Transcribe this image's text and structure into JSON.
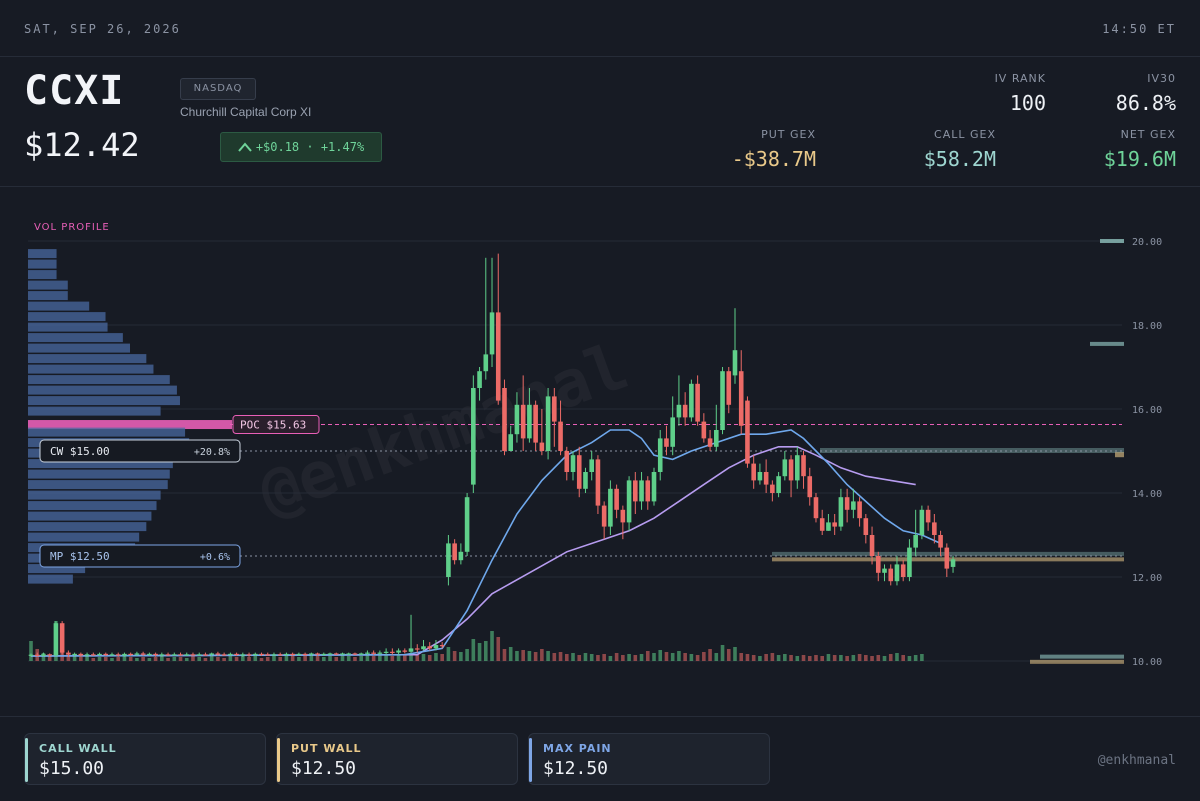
{
  "topbar": {
    "date": "SAT, SEP 26, 2026",
    "time": "14:50 ET"
  },
  "header": {
    "ticker": "CCXI",
    "price": "$12.42",
    "exchange": "NASDAQ",
    "company": "Churchill Capital Corp XI",
    "change": "+$0.18 · +1.47%",
    "change_icon": "chevron-up-icon"
  },
  "metrics": {
    "iv_rank": {
      "label": "IV RANK",
      "value": "100"
    },
    "iv30": {
      "label": "IV30",
      "value": "86.8%"
    },
    "put_gex": {
      "label": "PUT GEX",
      "value": "-$38.7M"
    },
    "call_gex": {
      "label": "CALL GEX",
      "value": "$58.2M"
    },
    "net_gex": {
      "label": "NET GEX",
      "value": "$19.6M"
    }
  },
  "colors": {
    "up": "#5fcf8a",
    "down": "#ec6b67",
    "ma_fast": "#6fa8ec",
    "ma_slow": "#b79cf0",
    "poc": "#e85fb7",
    "call": "#9ed6d0",
    "put": "#e9c98a",
    "maxpain": "#7ea6e6",
    "net": "#6fd49a"
  },
  "chart_data": {
    "type": "candlestick",
    "y_ticks": [
      "20.00",
      "18.00",
      "16.00",
      "14.00",
      "12.00",
      "10.00"
    ],
    "ylim": [
      10,
      20
    ],
    "vol_profile_label": "VOL PROFILE",
    "levels": [
      {
        "name": "poc",
        "label": "POC $15.63",
        "price": 15.63
      },
      {
        "name": "cw",
        "label": "CW $15.00",
        "pct": "+20.8%",
        "price": 15.0
      },
      {
        "name": "mp",
        "label": "MP $12.50",
        "pct": "+0.6%",
        "price": 12.5
      }
    ],
    "price_walls": [
      20.0,
      17.55,
      15.0,
      12.45,
      10.05
    ],
    "candles": [
      [
        10.13,
        10.15,
        10.1,
        10.18
      ],
      [
        10.15,
        10.12,
        10.1,
        10.2
      ],
      [
        10.12,
        10.16,
        10.1,
        10.2
      ],
      [
        10.16,
        10.13,
        10.1,
        10.18
      ],
      [
        10.13,
        10.9,
        10.1,
        10.95
      ],
      [
        10.9,
        10.2,
        10.15,
        10.95
      ],
      [
        10.2,
        10.15,
        10.1,
        10.25
      ],
      [
        10.15,
        10.17,
        10.1,
        10.2
      ],
      [
        10.17,
        10.13,
        10.1,
        10.2
      ],
      [
        10.13,
        10.16,
        10.1,
        10.2
      ],
      [
        10.16,
        10.15,
        10.12,
        10.2
      ],
      [
        10.15,
        10.17,
        10.12,
        10.2
      ],
      [
        10.17,
        10.14,
        10.12,
        10.2
      ],
      [
        10.14,
        10.16,
        10.12,
        10.2
      ],
      [
        10.16,
        10.13,
        10.1,
        10.2
      ],
      [
        10.13,
        10.17,
        10.1,
        10.2
      ],
      [
        10.17,
        10.15,
        10.12,
        10.2
      ],
      [
        10.15,
        10.18,
        10.12,
        10.22
      ],
      [
        10.18,
        10.15,
        10.12,
        10.22
      ],
      [
        10.15,
        10.17,
        10.12,
        10.2
      ],
      [
        10.17,
        10.14,
        10.1,
        10.2
      ],
      [
        10.14,
        10.16,
        10.1,
        10.2
      ],
      [
        10.16,
        10.15,
        10.12,
        10.2
      ],
      [
        10.15,
        10.16,
        10.12,
        10.2
      ],
      [
        10.16,
        10.14,
        10.12,
        10.2
      ],
      [
        10.14,
        10.16,
        10.12,
        10.2
      ],
      [
        10.16,
        10.15,
        10.12,
        10.2
      ],
      [
        10.15,
        10.16,
        10.12,
        10.2
      ],
      [
        10.16,
        10.15,
        10.12,
        10.2
      ],
      [
        10.15,
        10.18,
        10.12,
        10.2
      ],
      [
        10.18,
        10.16,
        10.12,
        10.22
      ],
      [
        10.16,
        10.15,
        10.12,
        10.2
      ],
      [
        10.15,
        10.17,
        10.12,
        10.2
      ],
      [
        10.17,
        10.15,
        10.12,
        10.2
      ],
      [
        10.15,
        10.16,
        10.1,
        10.2
      ],
      [
        10.16,
        10.14,
        10.1,
        10.2
      ],
      [
        10.14,
        10.17,
        10.12,
        10.2
      ],
      [
        10.17,
        10.16,
        10.12,
        10.2
      ],
      [
        10.16,
        10.15,
        10.12,
        10.2
      ],
      [
        10.15,
        10.16,
        10.12,
        10.2
      ],
      [
        10.16,
        10.15,
        10.12,
        10.2
      ],
      [
        10.15,
        10.17,
        10.12,
        10.2
      ],
      [
        10.17,
        10.16,
        10.12,
        10.2
      ],
      [
        10.16,
        10.17,
        10.12,
        10.2
      ],
      [
        10.17,
        10.16,
        10.12,
        10.2
      ],
      [
        10.16,
        10.18,
        10.12,
        10.2
      ],
      [
        10.18,
        10.17,
        10.12,
        10.2
      ],
      [
        10.17,
        10.17,
        10.12,
        10.2
      ],
      [
        10.17,
        10.18,
        10.14,
        10.2
      ],
      [
        10.18,
        10.17,
        10.14,
        10.2
      ],
      [
        10.17,
        10.18,
        10.14,
        10.2
      ],
      [
        10.18,
        10.18,
        10.14,
        10.2
      ],
      [
        10.18,
        10.17,
        10.14,
        10.2
      ],
      [
        10.17,
        10.18,
        10.14,
        10.2
      ],
      [
        10.18,
        10.2,
        10.14,
        10.25
      ],
      [
        10.2,
        10.18,
        10.14,
        10.25
      ],
      [
        10.18,
        10.2,
        10.14,
        10.25
      ],
      [
        10.2,
        10.22,
        10.15,
        10.3
      ],
      [
        10.22,
        10.2,
        10.15,
        10.3
      ],
      [
        10.2,
        10.25,
        10.15,
        10.3
      ],
      [
        10.25,
        10.22,
        10.18,
        10.3
      ],
      [
        10.22,
        10.3,
        10.18,
        11.1
      ],
      [
        10.3,
        10.28,
        10.2,
        10.4
      ],
      [
        10.28,
        10.35,
        10.25,
        10.5
      ],
      [
        10.35,
        10.3,
        10.25,
        10.45
      ],
      [
        10.3,
        10.38,
        10.25,
        10.5
      ],
      [
        10.38,
        10.35,
        10.3,
        10.45
      ],
      [
        12.0,
        12.8,
        11.8,
        13.0
      ],
      [
        12.8,
        12.4,
        12.3,
        12.9
      ],
      [
        12.4,
        12.6,
        12.3,
        12.8
      ],
      [
        12.6,
        13.9,
        12.5,
        14.0
      ],
      [
        14.2,
        16.5,
        14.0,
        16.8
      ],
      [
        16.5,
        16.9,
        16.2,
        17.0
      ],
      [
        16.9,
        17.3,
        16.7,
        19.6
      ],
      [
        17.3,
        18.3,
        17.0,
        19.6
      ],
      [
        18.3,
        16.2,
        16.1,
        19.7
      ],
      [
        16.5,
        15.0,
        14.9,
        16.7
      ],
      [
        15.0,
        15.4,
        15.0,
        15.6
      ],
      [
        15.4,
        16.1,
        15.2,
        16.4
      ],
      [
        16.1,
        15.3,
        15.0,
        16.8
      ],
      [
        15.3,
        16.1,
        15.2,
        16.5
      ],
      [
        16.1,
        15.2,
        15.0,
        16.2
      ],
      [
        15.2,
        15.0,
        14.9,
        16.0
      ],
      [
        15.0,
        16.3,
        14.8,
        16.5
      ],
      [
        16.3,
        15.7,
        15.1,
        16.5
      ],
      [
        15.7,
        15.0,
        14.9,
        16.2
      ],
      [
        15.0,
        14.5,
        14.3,
        15.1
      ],
      [
        14.5,
        14.9,
        14.3,
        15.0
      ],
      [
        14.9,
        14.1,
        13.9,
        15.1
      ],
      [
        14.1,
        14.5,
        14.0,
        14.6
      ],
      [
        14.5,
        14.8,
        14.3,
        15.0
      ],
      [
        14.8,
        13.7,
        13.5,
        14.9
      ],
      [
        13.7,
        13.2,
        12.9,
        13.8
      ],
      [
        13.2,
        14.1,
        13.0,
        14.3
      ],
      [
        14.1,
        13.6,
        13.4,
        14.2
      ],
      [
        13.6,
        13.3,
        12.9,
        13.7
      ],
      [
        13.3,
        14.3,
        13.1,
        14.4
      ],
      [
        14.3,
        13.8,
        13.5,
        14.5
      ],
      [
        13.8,
        14.3,
        13.6,
        14.5
      ],
      [
        14.3,
        13.8,
        13.6,
        14.4
      ],
      [
        13.8,
        14.5,
        13.7,
        14.6
      ],
      [
        14.5,
        15.3,
        14.3,
        15.5
      ],
      [
        15.3,
        15.1,
        14.9,
        15.6
      ],
      [
        15.1,
        15.8,
        14.9,
        16.3
      ],
      [
        15.8,
        16.1,
        15.6,
        16.8
      ],
      [
        16.1,
        15.8,
        15.6,
        16.4
      ],
      [
        15.8,
        16.6,
        15.7,
        16.7
      ],
      [
        16.6,
        15.7,
        15.6,
        16.8
      ],
      [
        15.7,
        15.3,
        15.2,
        15.9
      ],
      [
        15.3,
        15.1,
        15.0,
        15.5
      ],
      [
        15.1,
        15.5,
        15.0,
        16.1
      ],
      [
        15.5,
        16.9,
        15.4,
        17.0
      ],
      [
        16.9,
        16.1,
        15.9,
        17.0
      ],
      [
        16.8,
        17.4,
        16.6,
        18.4
      ],
      [
        16.9,
        15.6,
        15.4,
        17.4
      ],
      [
        16.2,
        14.7,
        14.6,
        16.3
      ],
      [
        14.7,
        14.3,
        14.1,
        14.9
      ],
      [
        14.3,
        14.5,
        14.2,
        14.7
      ],
      [
        14.5,
        14.2,
        14.0,
        14.8
      ],
      [
        14.2,
        14.0,
        13.8,
        14.3
      ],
      [
        14.0,
        14.4,
        13.9,
        14.5
      ],
      [
        14.4,
        14.8,
        14.3,
        15.0
      ],
      [
        14.8,
        14.3,
        13.9,
        14.9
      ],
      [
        14.3,
        14.9,
        14.1,
        15.1
      ],
      [
        14.9,
        14.4,
        14.1,
        15.0
      ],
      [
        14.4,
        13.9,
        13.7,
        14.6
      ],
      [
        13.9,
        13.4,
        13.3,
        14.0
      ],
      [
        13.4,
        13.1,
        13.0,
        13.6
      ],
      [
        13.1,
        13.3,
        13.1,
        13.5
      ],
      [
        13.3,
        13.2,
        13.0,
        13.5
      ],
      [
        13.2,
        13.9,
        13.1,
        14.1
      ],
      [
        13.9,
        13.6,
        13.3,
        14.1
      ],
      [
        13.6,
        13.8,
        13.4,
        14.1
      ],
      [
        13.8,
        13.4,
        13.2,
        13.9
      ],
      [
        13.4,
        13.0,
        12.8,
        13.5
      ],
      [
        13.0,
        12.5,
        12.3,
        13.2
      ],
      [
        12.5,
        12.1,
        11.9,
        12.6
      ],
      [
        12.1,
        12.2,
        11.9,
        12.3
      ],
      [
        12.2,
        11.9,
        11.8,
        12.3
      ],
      [
        11.9,
        12.3,
        11.8,
        12.5
      ],
      [
        12.3,
        12.0,
        11.9,
        12.4
      ],
      [
        12.0,
        12.7,
        11.9,
        12.9
      ],
      [
        12.7,
        13.0,
        12.5,
        13.6
      ],
      [
        13.0,
        13.6,
        12.9,
        13.7
      ],
      [
        13.6,
        13.3,
        13.1,
        13.7
      ],
      [
        13.3,
        13.0,
        12.8,
        13.5
      ],
      [
        13.0,
        12.7,
        12.5,
        13.1
      ],
      [
        12.7,
        12.2,
        12.0,
        12.8
      ],
      [
        12.24,
        12.42,
        12.1,
        12.5
      ]
    ],
    "volumes": [
      20,
      12,
      8,
      6,
      40,
      10,
      6,
      5,
      4,
      5,
      3,
      4,
      4,
      3,
      4,
      5,
      4,
      3,
      4,
      3,
      4,
      5,
      3,
      4,
      4,
      3,
      5,
      4,
      3,
      6,
      4,
      3,
      5,
      4,
      6,
      4,
      5,
      3,
      4,
      5,
      4,
      6,
      5,
      4,
      5,
      6,
      5,
      4,
      5,
      4,
      6,
      5,
      4,
      5,
      6,
      5,
      7,
      6,
      5,
      6,
      7,
      8,
      6,
      7,
      6,
      8,
      7,
      14,
      10,
      9,
      12,
      22,
      18,
      20,
      30,
      24,
      12,
      14,
      10,
      11,
      10,
      9,
      12,
      10,
      8,
      9,
      7,
      8,
      6,
      8,
      7,
      6,
      7,
      5,
      8,
      6,
      7,
      6,
      7,
      10,
      8,
      11,
      9,
      8,
      10,
      8,
      7,
      6,
      9,
      12,
      8,
      16,
      12,
      14,
      8,
      7,
      6,
      5,
      7,
      8,
      6,
      7,
      6,
      5,
      6,
      5,
      6,
      5,
      7,
      6,
      6,
      5,
      6,
      7,
      6,
      5,
      6,
      5,
      7,
      8,
      6,
      5,
      6,
      7
    ],
    "ma_fast": [
      [
        0,
        10.12
      ],
      [
        60,
        10.15
      ],
      [
        66,
        10.3
      ],
      [
        70,
        11.2
      ],
      [
        74,
        12.4
      ],
      [
        78,
        13.5
      ],
      [
        82,
        14.3
      ],
      [
        86,
        14.9
      ],
      [
        90,
        15.2
      ],
      [
        93,
        15.5
      ],
      [
        96,
        15.5
      ],
      [
        98,
        15.3
      ],
      [
        100,
        14.9
      ],
      [
        103,
        14.8
      ],
      [
        106,
        15.0
      ],
      [
        110,
        15.2
      ],
      [
        114,
        15.4
      ],
      [
        118,
        15.4
      ],
      [
        122,
        15.5
      ],
      [
        124,
        15.3
      ],
      [
        128,
        14.7
      ],
      [
        131,
        14.2
      ],
      [
        134,
        13.8
      ],
      [
        137,
        13.4
      ],
      [
        140,
        13.1
      ],
      [
        143,
        13.0
      ],
      [
        146,
        12.8
      ]
    ],
    "ma_slow": [
      [
        0,
        10.12
      ],
      [
        62,
        10.15
      ],
      [
        66,
        10.5
      ],
      [
        70,
        11.0
      ],
      [
        74,
        11.6
      ],
      [
        80,
        12.1
      ],
      [
        86,
        12.6
      ],
      [
        92,
        12.9
      ],
      [
        96,
        13.1
      ],
      [
        100,
        13.4
      ],
      [
        104,
        13.8
      ],
      [
        108,
        14.2
      ],
      [
        112,
        14.6
      ],
      [
        116,
        14.9
      ],
      [
        120,
        15.1
      ],
      [
        123,
        15.1
      ],
      [
        126,
        14.9
      ],
      [
        130,
        14.6
      ],
      [
        134,
        14.4
      ],
      [
        138,
        14.3
      ],
      [
        142,
        14.2
      ]
    ],
    "vol_profile": [
      [
        19.7,
        0.28
      ],
      [
        19.45,
        0.28
      ],
      [
        19.2,
        0.28
      ],
      [
        18.95,
        0.39
      ],
      [
        18.7,
        0.39
      ],
      [
        18.45,
        0.6
      ],
      [
        18.2,
        0.76
      ],
      [
        17.95,
        0.78
      ],
      [
        17.7,
        0.93
      ],
      [
        17.45,
        1.0
      ],
      [
        17.2,
        1.16
      ],
      [
        16.95,
        1.23
      ],
      [
        16.7,
        1.39
      ],
      [
        16.45,
        1.46
      ],
      [
        16.2,
        1.49
      ],
      [
        15.95,
        1.3
      ],
      [
        15.63,
        2.0
      ],
      [
        15.45,
        1.54
      ],
      [
        15.2,
        1.58
      ],
      [
        14.95,
        1.47
      ],
      [
        14.7,
        1.42
      ],
      [
        14.45,
        1.39
      ],
      [
        14.2,
        1.37
      ],
      [
        13.95,
        1.3
      ],
      [
        13.7,
        1.26
      ],
      [
        13.45,
        1.21
      ],
      [
        13.2,
        1.16
      ],
      [
        12.95,
        1.09
      ],
      [
        12.7,
        1.05
      ],
      [
        12.45,
        0.98
      ],
      [
        12.2,
        0.56
      ],
      [
        11.95,
        0.44
      ]
    ]
  },
  "footer": {
    "call_wall": {
      "label": "CALL WALL",
      "value": "$15.00"
    },
    "put_wall": {
      "label": "PUT WALL",
      "value": "$12.50"
    },
    "max_pain": {
      "label": "MAX PAIN",
      "value": "$12.50"
    },
    "handle": "@enkhmanal"
  },
  "watermark": "@enkhmanal"
}
